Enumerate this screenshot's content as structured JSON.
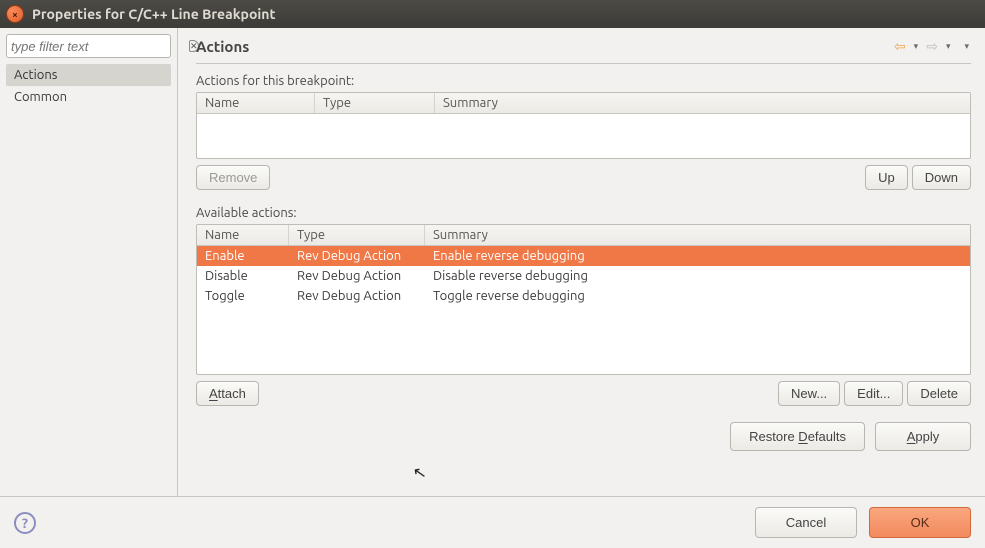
{
  "window": {
    "title": "Properties for C/C++ Line Breakpoint"
  },
  "sidebar": {
    "filter_placeholder": "type filter text",
    "items": [
      {
        "label": "Actions",
        "selected": true
      },
      {
        "label": "Common",
        "selected": false
      }
    ]
  },
  "page": {
    "title": "Actions"
  },
  "breakpoint_actions": {
    "label": "Actions for this breakpoint:",
    "columns": {
      "name": "Name",
      "type": "Type",
      "summary": "Summary"
    },
    "rows": [],
    "buttons": {
      "remove": "Remove",
      "up": "Up",
      "down": "Down"
    }
  },
  "available_actions": {
    "label": "Available actions:",
    "columns": {
      "name": "Name",
      "type": "Type",
      "summary": "Summary"
    },
    "rows": [
      {
        "name": "Enable",
        "type": "Rev Debug Action",
        "summary": "Enable reverse debugging",
        "selected": true
      },
      {
        "name": "Disable",
        "type": "Rev Debug Action",
        "summary": "Disable reverse debugging",
        "selected": false
      },
      {
        "name": "Toggle",
        "type": "Rev Debug Action",
        "summary": "Toggle reverse debugging",
        "selected": false
      }
    ],
    "buttons": {
      "attach": "Attach",
      "new": "New...",
      "edit": "Edit...",
      "delete": "Delete"
    }
  },
  "bottom": {
    "restore_defaults": "Restore Defaults",
    "apply": "Apply"
  },
  "footer": {
    "cancel": "Cancel",
    "ok": "OK"
  }
}
